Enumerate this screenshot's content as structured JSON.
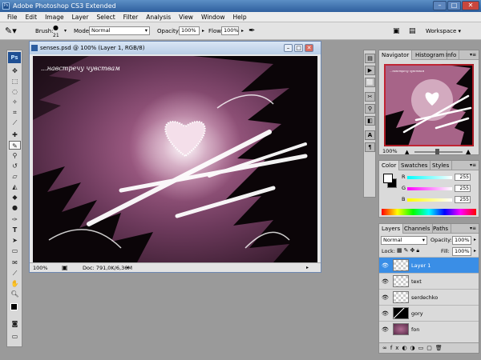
{
  "window": {
    "title": "Adobe Photoshop CS3 Extended"
  },
  "menu": [
    "File",
    "Edit",
    "Image",
    "Layer",
    "Select",
    "Filter",
    "Analysis",
    "View",
    "Window",
    "Help"
  ],
  "options": {
    "brush_label": "Brush:",
    "brush_size": "21",
    "mode_label": "Mode:",
    "mode_value": "Normal",
    "opacity_label": "Opacity:",
    "opacity_value": "100%",
    "flow_label": "Flow:",
    "flow_value": "100%",
    "workspace": "Workspace ▾"
  },
  "document": {
    "title": "senses.psd @ 100% (Layer 1, RGB/8)",
    "canvas_text": "...навстречу чувствам",
    "zoom": "100%",
    "doc_info": "Doc: 791,0K/6,36M"
  },
  "navigator": {
    "tabs": [
      "Navigator",
      "Histogram",
      "Info"
    ],
    "zoom": "100%",
    "thumb_text": "...навстречу чувствам"
  },
  "color": {
    "tabs": [
      "Color",
      "Swatches",
      "Styles"
    ],
    "r_label": "R",
    "g_label": "G",
    "b_label": "B",
    "r": "255",
    "g": "255",
    "b": "255"
  },
  "layers": {
    "tabs": [
      "Layers",
      "Channels",
      "Paths"
    ],
    "blend": "Normal",
    "opacity_label": "Opacity:",
    "opacity": "100%",
    "lock_label": "Lock:",
    "fill_label": "Fill:",
    "fill": "100%",
    "items": [
      {
        "name": "Layer 1",
        "selected": true
      },
      {
        "name": "text"
      },
      {
        "name": "serdechko"
      },
      {
        "name": "gory"
      },
      {
        "name": "fon"
      }
    ]
  },
  "colors": {
    "accent": "#3a8ee6",
    "canvas_pink": "#8a4a73"
  }
}
